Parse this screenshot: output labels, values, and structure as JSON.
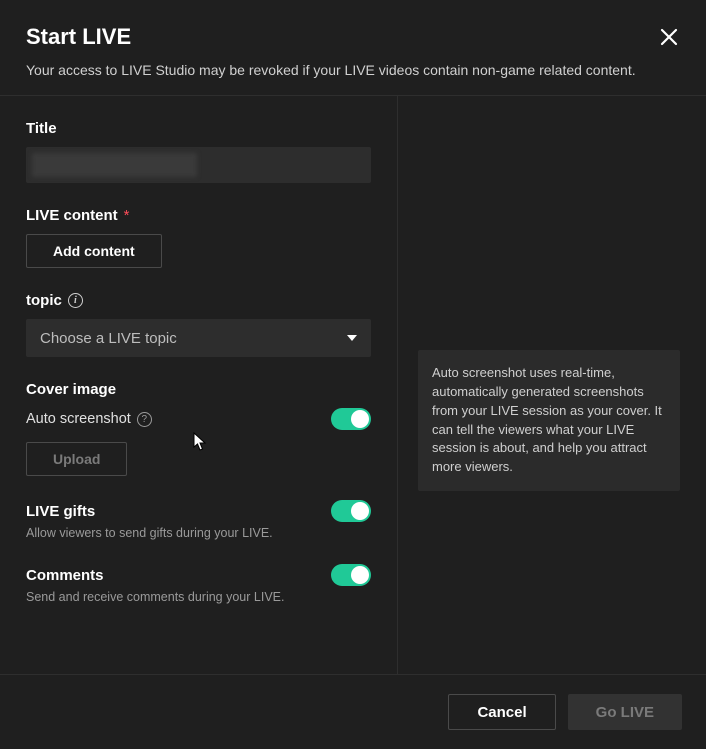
{
  "header": {
    "title": "Start LIVE",
    "subtitle": "Your access to LIVE Studio may be revoked if your LIVE videos contain non-game related content."
  },
  "form": {
    "title_label": "Title",
    "live_content_label": "LIVE content",
    "add_content_button": "Add content",
    "topic_label": "topic",
    "topic_placeholder": "Choose a LIVE topic",
    "cover_label": "Cover image",
    "auto_screenshot_label": "Auto screenshot",
    "upload_button": "Upload",
    "live_gifts": {
      "label": "LIVE gifts",
      "sub": "Allow viewers to send gifts during your LIVE.",
      "on": true
    },
    "comments": {
      "label": "Comments",
      "sub": "Send and receive comments during your LIVE.",
      "on": true
    },
    "auto_screenshot_on": true
  },
  "tooltip": "Auto screenshot uses real-time, automatically generated screenshots from your LIVE session as your cover. It can tell the viewers what your LIVE session is about, and help you attract more viewers.",
  "footer": {
    "cancel": "Cancel",
    "go_live": "Go LIVE"
  }
}
